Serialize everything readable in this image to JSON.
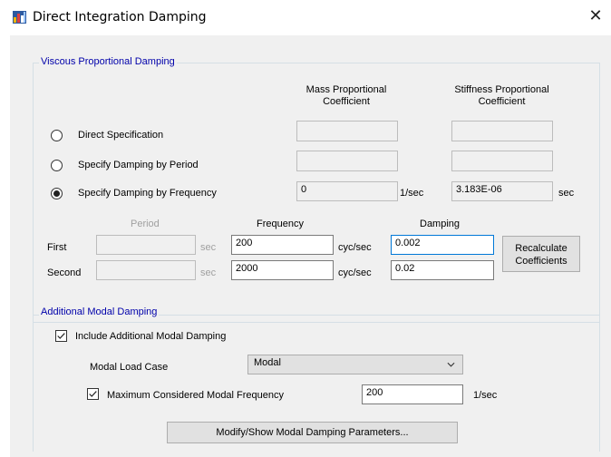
{
  "window": {
    "title": "Direct Integration Damping"
  },
  "viscous": {
    "group_label": "Viscous Proportional Damping",
    "mass_header": "Mass Proportional Coefficient",
    "mass_header_l1": "Mass Proportional",
    "mass_header_l2": "Coefficient",
    "stiff_header_l1": "Stiffness Proportional",
    "stiff_header_l2": "Coefficient",
    "options": [
      {
        "label": "Direct Specification",
        "checked": false
      },
      {
        "label": "Specify Damping by Period",
        "checked": false
      },
      {
        "label": "Specify Damping by Frequency",
        "checked": true
      }
    ],
    "mass_value": "0",
    "mass_unit": "1/sec",
    "stiff_value": "3.183E-06",
    "stiff_unit": "sec",
    "col_period": "Period",
    "col_frequency": "Frequency",
    "col_damping": "Damping",
    "rows": [
      {
        "label": "First",
        "period": "",
        "period_unit": "sec",
        "frequency": "200",
        "freq_unit": "cyc/sec",
        "damping": "0.002"
      },
      {
        "label": "Second",
        "period": "",
        "period_unit": "sec",
        "frequency": "2000",
        "freq_unit": "cyc/sec",
        "damping": "0.02"
      }
    ],
    "recalc_l1": "Recalculate",
    "recalc_l2": "Coefficients"
  },
  "modal": {
    "group_label": "Additional Modal Damping",
    "include_label": "Include Additional Modal Damping",
    "include_checked": true,
    "load_case_label": "Modal Load Case",
    "load_case_value": "Modal",
    "max_freq_label": "Maximum Considered Modal Frequency",
    "max_freq_checked": true,
    "max_freq_value": "200",
    "max_freq_unit": "1/sec",
    "modify_button": "Modify/Show Modal Damping Parameters..."
  }
}
